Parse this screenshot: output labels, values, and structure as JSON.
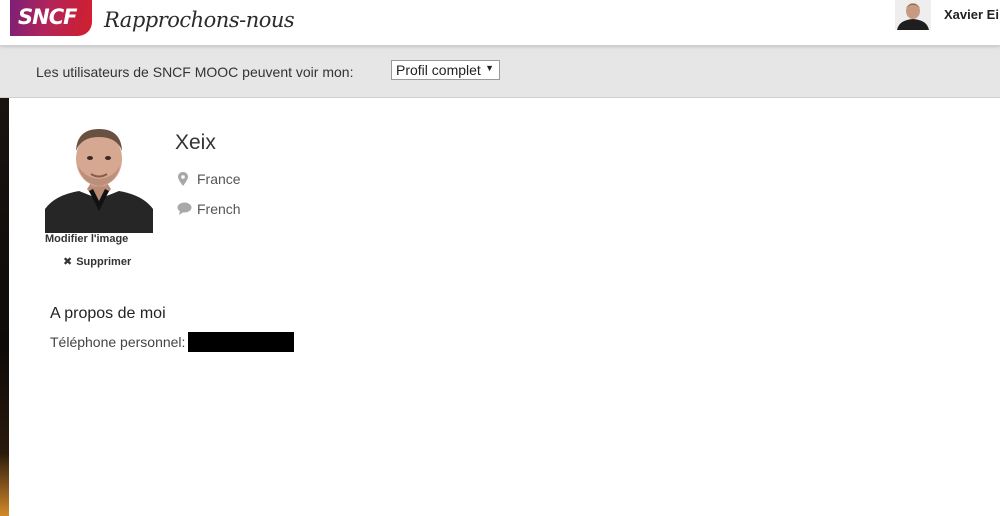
{
  "header": {
    "logo_text": "SNCF",
    "tagline": "Rapprochons-nous",
    "user_name": "Xavier Ei",
    "brand_gradient": [
      "#7b1f78",
      "#d21f2c"
    ]
  },
  "privacy": {
    "label": "Les utilisateurs de SNCF MOOC peuvent voir mon:",
    "selected": "Profil complet"
  },
  "profile": {
    "modify_image": "Modifier l'image",
    "delete_image": "Supprimer",
    "display_name": "Xeix",
    "location": "France",
    "language": "French",
    "location_icon": "map-pin-icon",
    "language_icon": "speech-bubble-icon"
  },
  "about": {
    "title": "A propos de moi",
    "phone_label": "Téléphone personnel:"
  }
}
